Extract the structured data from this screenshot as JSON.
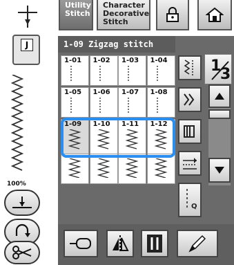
{
  "tabs": {
    "utility": "Utility\nStitch",
    "character": "Character\nDecorative\nStitch"
  },
  "header": {
    "title": "1-09  Zigzag stitch"
  },
  "foot": {
    "letter": "J"
  },
  "zoom": {
    "label": "100%"
  },
  "page": {
    "current": "1",
    "total": "3"
  },
  "stitches": [
    {
      "id": "1-01"
    },
    {
      "id": "1-02"
    },
    {
      "id": "1-03"
    },
    {
      "id": "1-04"
    },
    {
      "id": "1-05"
    },
    {
      "id": "1-06"
    },
    {
      "id": "1-07"
    },
    {
      "id": "1-08"
    },
    {
      "id": "1-09"
    },
    {
      "id": "1-10"
    },
    {
      "id": "1-11"
    },
    {
      "id": "1-12"
    },
    {
      "id": ""
    },
    {
      "id": ""
    },
    {
      "id": ""
    },
    {
      "id": ""
    }
  ],
  "selected_stitch": "1-09",
  "icons": [
    "needle-icon",
    "presser-foot-icon",
    "lock-icon",
    "home-icon",
    "needle-position-icon",
    "reverse-icon",
    "scissors-icon",
    "mirror-icon",
    "twin-needle-icon",
    "pencil-icon"
  ]
}
